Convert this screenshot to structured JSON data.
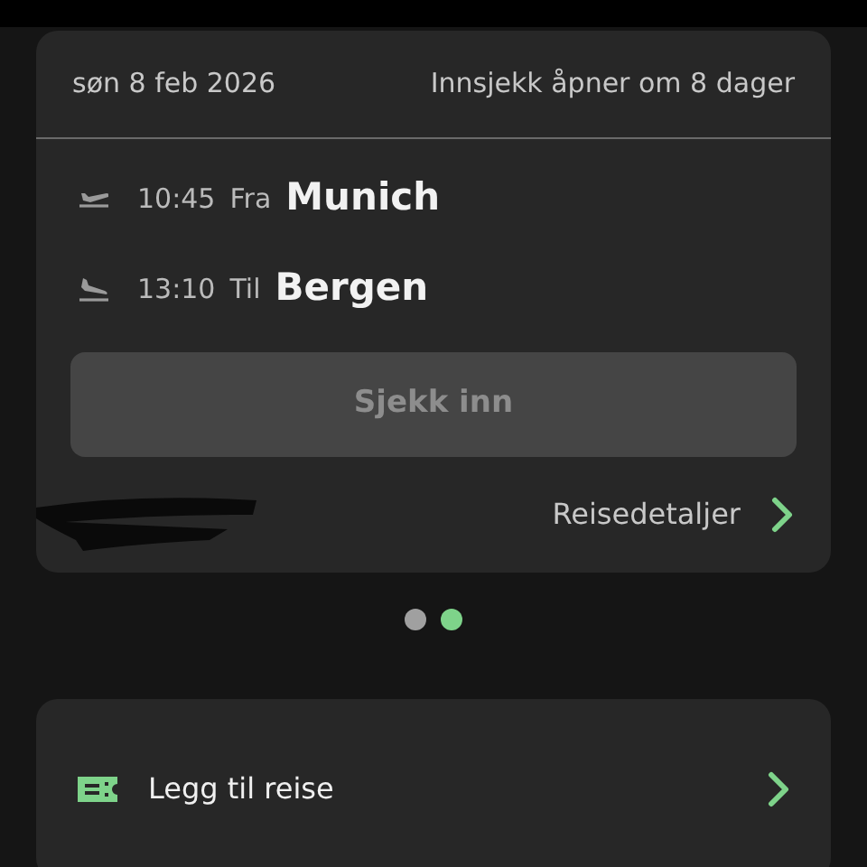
{
  "trip_card": {
    "date": "søn 8 feb 2026",
    "checkin_notice": "Innsjekk åpner om 8 dager",
    "legs": [
      {
        "kind": "departure",
        "time": "10:45",
        "direction": "Fra",
        "city": "Munich"
      },
      {
        "kind": "arrival",
        "time": "13:10",
        "direction": "Til",
        "city": "Bergen"
      }
    ],
    "checkin_button": {
      "label": "Sjekk inn",
      "disabled": true
    },
    "details_link": "Reisedetaljer"
  },
  "pager": [
    {
      "selected": false
    },
    {
      "selected": true
    }
  ],
  "add_trip": {
    "label": "Legg til reise"
  }
}
